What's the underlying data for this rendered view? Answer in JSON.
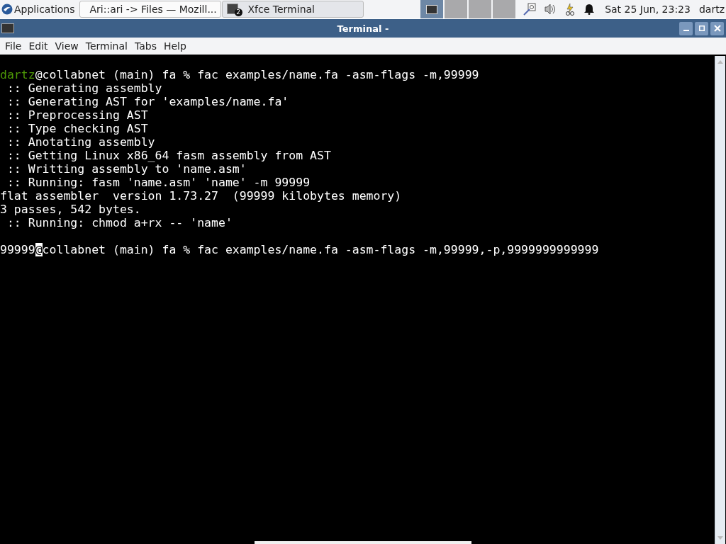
{
  "taskbar": {
    "apps_label": "Applications",
    "tasks": [
      {
        "title": "Ari::ari -> Files — Mozill...",
        "kind": "browser",
        "selected": false
      },
      {
        "title": "Xfce Terminal",
        "kind": "terminal",
        "badge": "2",
        "selected": true
      }
    ],
    "workspaces": [
      {
        "selected": true
      },
      {
        "selected": false
      },
      {
        "selected": false
      },
      {
        "selected": false
      }
    ],
    "clock": "Sat 25 Jun, 23:23",
    "user": "dartz"
  },
  "window": {
    "title": "Terminal -"
  },
  "menu": [
    "File",
    "Edit",
    "View",
    "Terminal",
    "Tabs",
    "Help"
  ],
  "terminal": {
    "lines": [
      {
        "kind": "blank"
      },
      {
        "kind": "prompt",
        "user": "dartz",
        "color": "#4e9a06",
        "at": "@",
        "rest": "collabnet (main) fa % fac examples/name.fa -asm-flags -m,99999",
        "cursor": false
      },
      {
        "kind": "output",
        "text": " :: Generating assembly"
      },
      {
        "kind": "output",
        "text": " :: Generating AST for 'examples/name.fa'"
      },
      {
        "kind": "output",
        "text": " :: Preprocessing AST"
      },
      {
        "kind": "output",
        "text": " :: Type checking AST"
      },
      {
        "kind": "output",
        "text": " :: Anotating assembly"
      },
      {
        "kind": "output",
        "text": " :: Getting Linux x86_64 fasm assembly from AST"
      },
      {
        "kind": "output",
        "text": " :: Writting assembly to 'name.asm'"
      },
      {
        "kind": "output",
        "text": " :: Running: fasm 'name.asm' 'name' -m 99999"
      },
      {
        "kind": "output",
        "text": "flat assembler  version 1.73.27  (99999 kilobytes memory)"
      },
      {
        "kind": "output",
        "text": "3 passes, 542 bytes."
      },
      {
        "kind": "output",
        "text": " :: Running: chmod a+rx -- 'name'"
      },
      {
        "kind": "blank"
      },
      {
        "kind": "prompt",
        "user": "99999",
        "color": "#ffffff",
        "at": "@",
        "rest": "collabnet (main) fa % fac examples/name.fa -asm-flags -m,99999,-p,9999999999999",
        "cursor": true
      }
    ]
  }
}
